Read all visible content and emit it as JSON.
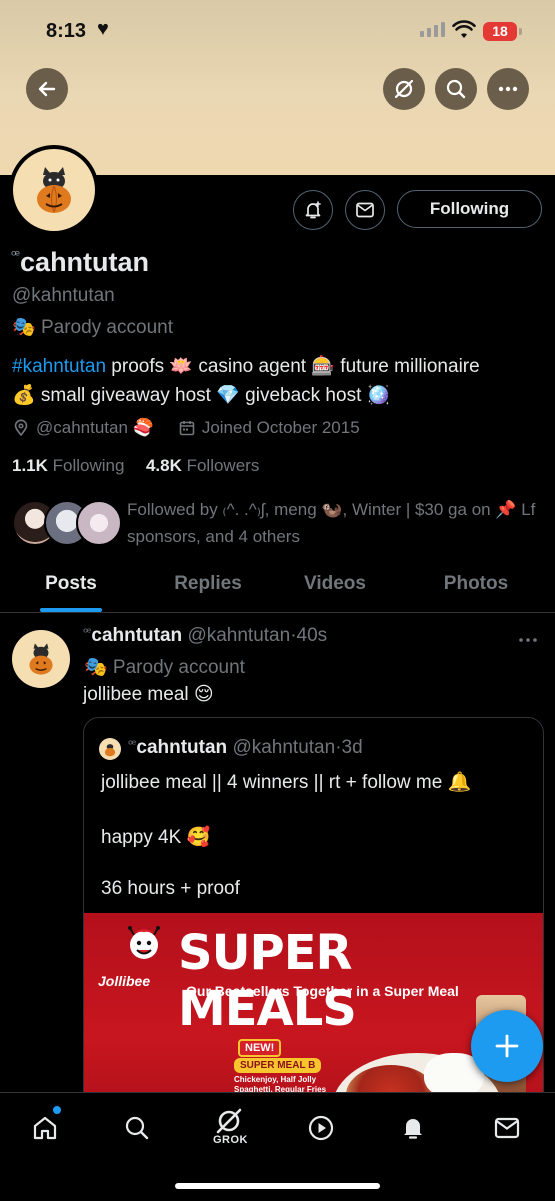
{
  "status_bar": {
    "time": "8:13",
    "heart": "♥",
    "battery": "18"
  },
  "header": {
    "back_icon": "arrow-left-icon",
    "grok_icon": "grok-slash-icon",
    "search_icon": "search-icon",
    "more_icon": "more-horizontal-icon",
    "banner_color": "#e8d5b0"
  },
  "profile": {
    "name_prefix": "ꟹ",
    "name": "cahntutan",
    "handle": "@kahntutan",
    "parody_emoji": "🎭",
    "parody_label": "Parody account",
    "follow_label": "Following",
    "bio_tag": "#kahntutan",
    "bio_line1_rest": " proofs 🪷 casino agent 🎰 future millionaire",
    "bio_line2": "💰 small giveaway host 💎 giveback host 🪩",
    "location": "@cahntutan 🍣",
    "joined": "Joined October 2015",
    "following_count": "1.1K",
    "following_label": " Following",
    "followers_count": "4.8K",
    "followers_label": " Followers",
    "followed_by": "Followed by ₍^. .^₎ʃ, meng 🦦, Winter | $30 ga on 📌 Lf sponsors, and 4 others"
  },
  "tabs": [
    {
      "label": "Posts",
      "active": true
    },
    {
      "label": "Replies",
      "active": false
    },
    {
      "label": "Videos",
      "active": false
    },
    {
      "label": "Photos",
      "active": false
    }
  ],
  "post": {
    "name": "cahntutan",
    "handle": "@kahntutan",
    "time": "40s",
    "parody": "🎭 Parody account",
    "text": "jollibee meal 😌",
    "quote": {
      "name": "cahntutan",
      "handle": "@kahntutan",
      "time": "3d",
      "line1": "jollibee meal || 4 winners || rt + follow me 🔔",
      "line2": "happy 4K 🥰",
      "line3": "36 hours + proof",
      "image": {
        "title": "SUPER MEALS",
        "brand": "Jollibee",
        "subtitle": "Our Bestsellers Together in a Super Meal",
        "badge": "NEW!",
        "meal": "SUPER MEAL B",
        "desc": "Chickenjoy, Half Jolly Spaghetti, Regular Fries Rice & Drink"
      }
    }
  },
  "bottom_nav": {
    "items": [
      "home-icon",
      "search-icon",
      "grok-icon",
      "play-icon",
      "bell-icon",
      "mail-icon"
    ],
    "grok_label": "GROK"
  },
  "colors": {
    "accent": "#1d9bf0",
    "muted": "#71767b",
    "text": "#e7e9ea",
    "border": "#2f3336"
  }
}
